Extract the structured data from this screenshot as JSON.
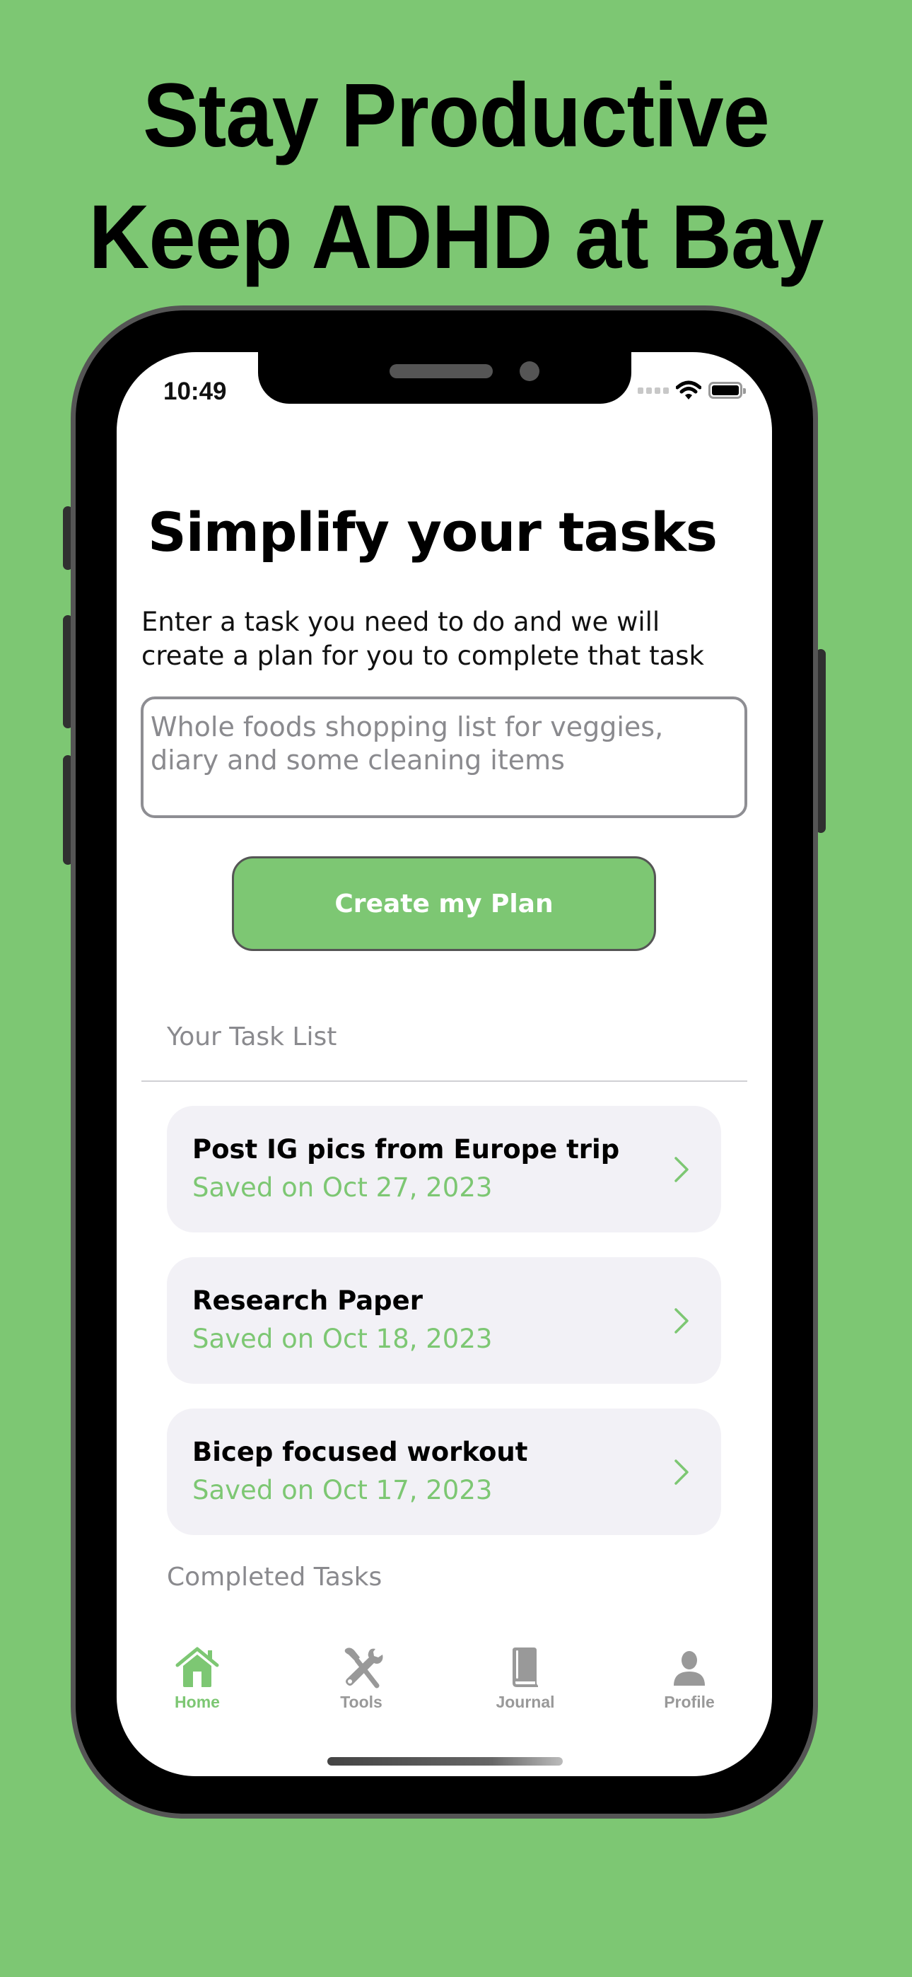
{
  "promo": {
    "headline_line1": "Stay Productive",
    "headline_line2": "Keep ADHD at Bay",
    "background_color": "#7dc773"
  },
  "status_bar": {
    "time": "10:49",
    "icons": [
      "cellular-signal-icon",
      "wifi-icon",
      "battery-icon"
    ]
  },
  "main": {
    "title": "Simplify your tasks",
    "subtitle": "Enter a task you need to do and we will create a plan for you to complete that task",
    "task_input": {
      "value": "",
      "placeholder": "Whole foods shopping list for veggies, diary and some cleaning items"
    },
    "create_button_label": "Create my Plan",
    "task_list_label": "Your Task List",
    "tasks": [
      {
        "title": "Post IG pics from Europe  trip",
        "date": "Saved on Oct 27, 2023"
      },
      {
        "title": "Research Paper",
        "date": "Saved on Oct 18, 2023"
      },
      {
        "title": "Bicep focused workout",
        "date": "Saved on Oct 17, 2023"
      }
    ],
    "completed_label": "Completed Tasks"
  },
  "tab_bar": {
    "active": "Home",
    "accent_color": "#7dc773",
    "inactive_color": "#999999",
    "tabs": [
      {
        "label": "Home",
        "icon": "house-icon"
      },
      {
        "label": "Tools",
        "icon": "tools-icon"
      },
      {
        "label": "Journal",
        "icon": "book-icon"
      },
      {
        "label": "Profile",
        "icon": "person-icon"
      }
    ]
  }
}
